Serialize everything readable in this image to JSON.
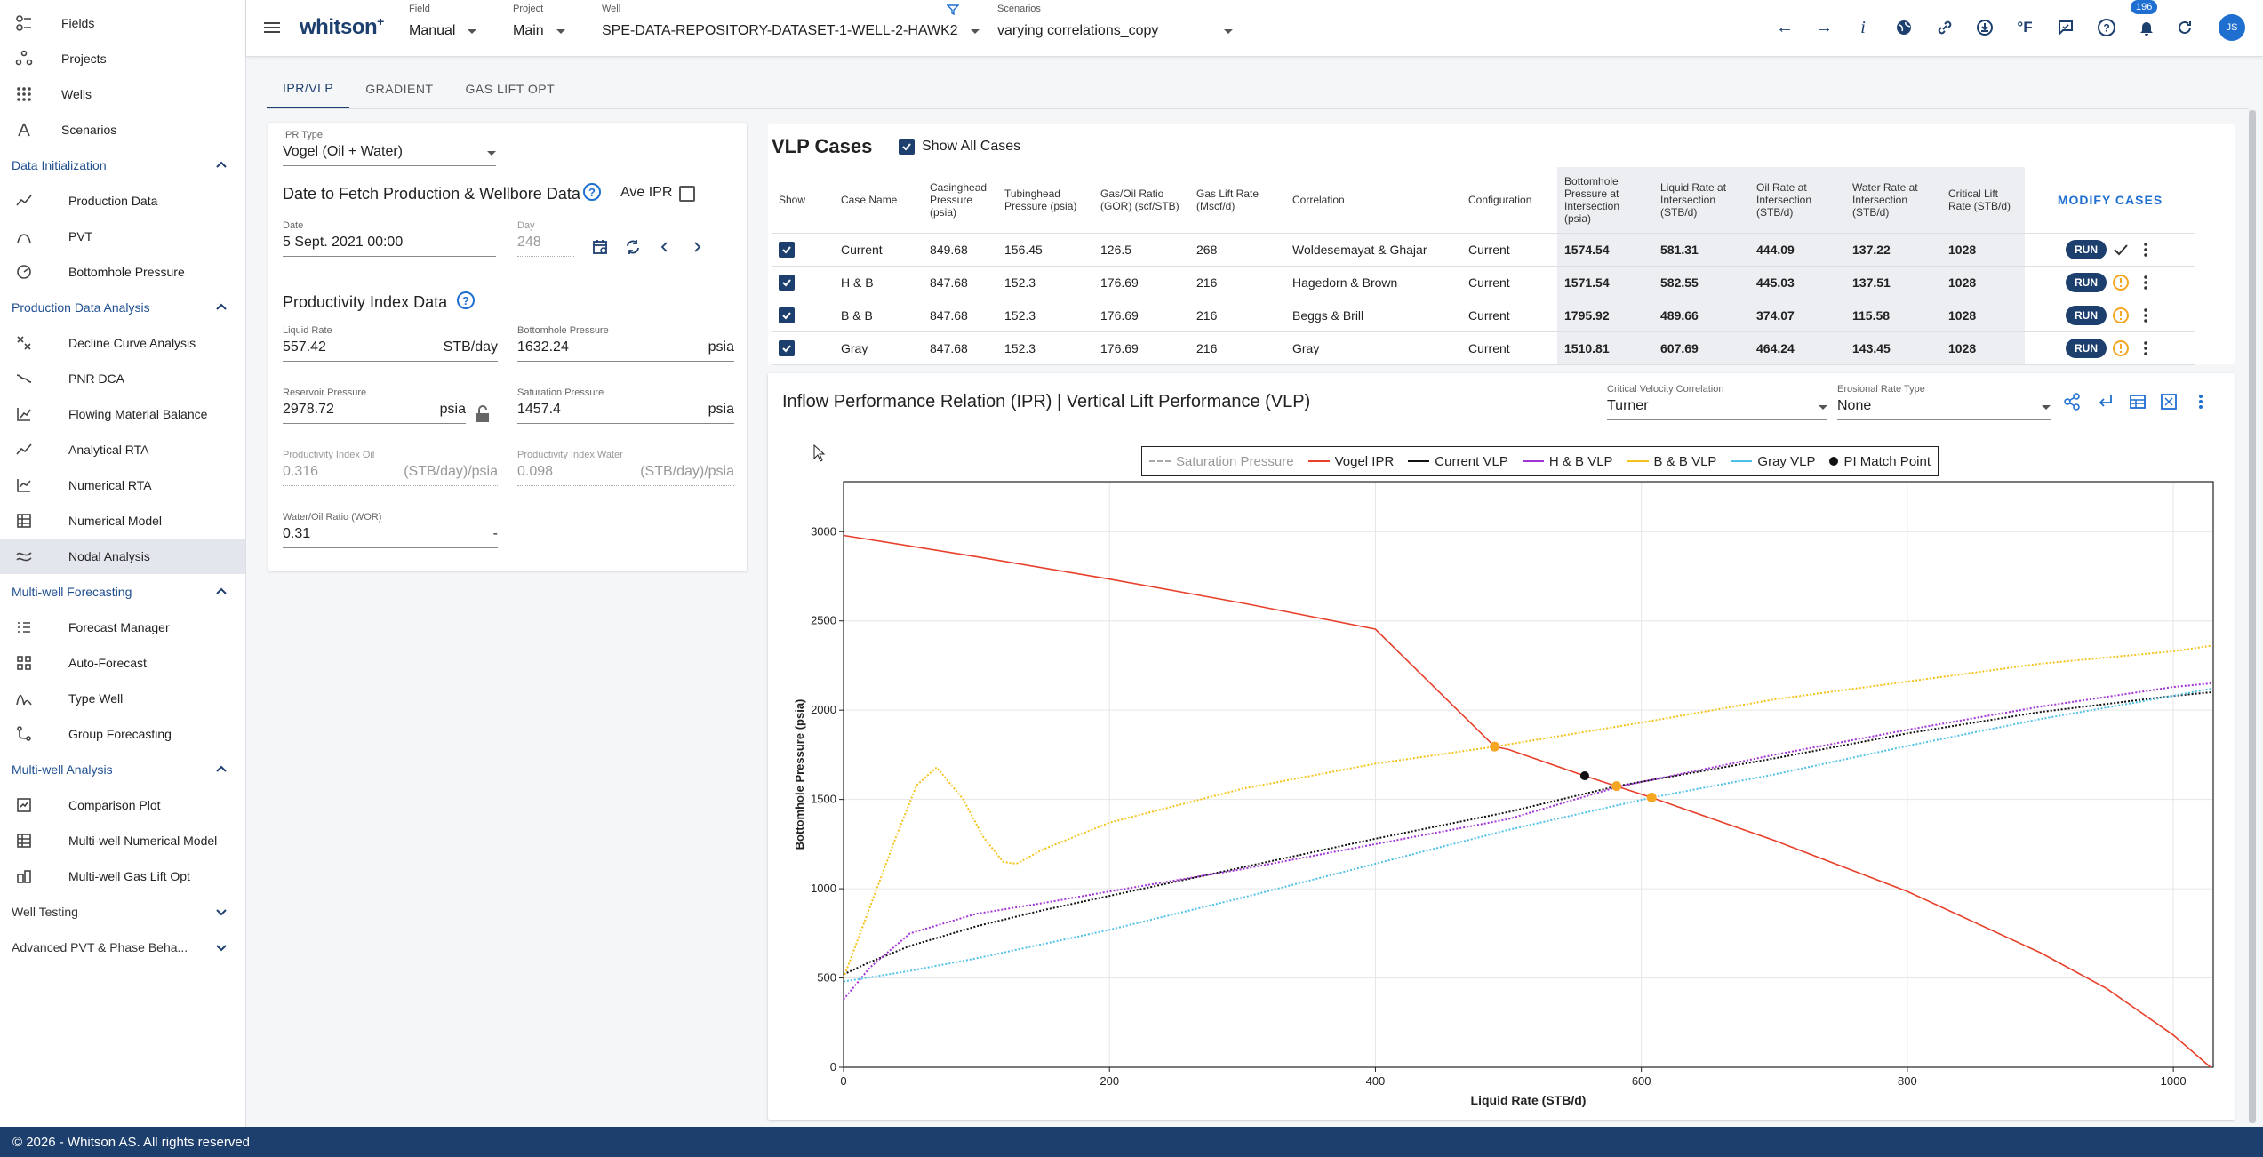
{
  "sidebar": {
    "top": [
      {
        "label": "Fields",
        "icon": "fields-icon"
      },
      {
        "label": "Projects",
        "icon": "projects-icon"
      },
      {
        "label": "Wells",
        "icon": "wells-icon"
      },
      {
        "label": "Scenarios",
        "icon": "scenarios-icon"
      }
    ],
    "sections": [
      {
        "label": "Data Initialization",
        "expanded": true,
        "items": [
          {
            "label": "Production Data",
            "icon": "production-data-icon"
          },
          {
            "label": "PVT",
            "icon": "pvt-icon"
          },
          {
            "label": "Bottomhole Pressure",
            "icon": "bottomhole-pressure-icon"
          }
        ]
      },
      {
        "label": "Production Data Analysis",
        "expanded": true,
        "items": [
          {
            "label": "Decline Curve Analysis",
            "icon": "decline-curve-icon"
          },
          {
            "label": "PNR DCA",
            "icon": "pnr-dca-icon"
          },
          {
            "label": "Flowing Material Balance",
            "icon": "flowing-material-balance-icon"
          },
          {
            "label": "Analytical RTA",
            "icon": "analytical-rta-icon"
          },
          {
            "label": "Numerical RTA",
            "icon": "numerical-rta-icon"
          },
          {
            "label": "Numerical Model",
            "icon": "numerical-model-icon"
          },
          {
            "label": "Nodal Analysis",
            "icon": "nodal-analysis-icon",
            "active": true
          }
        ]
      },
      {
        "label": "Multi-well Forecasting",
        "expanded": true,
        "items": [
          {
            "label": "Forecast Manager",
            "icon": "forecast-manager-icon"
          },
          {
            "label": "Auto-Forecast",
            "icon": "auto-forecast-icon"
          },
          {
            "label": "Type Well",
            "icon": "type-well-icon"
          },
          {
            "label": "Group Forecasting",
            "icon": "group-forecasting-icon"
          }
        ]
      },
      {
        "label": "Multi-well Analysis",
        "expanded": true,
        "items": [
          {
            "label": "Comparison Plot",
            "icon": "comparison-plot-icon"
          },
          {
            "label": "Multi-well Numerical Model",
            "icon": "multiwell-numerical-model-icon"
          },
          {
            "label": "Multi-well Gas Lift Opt",
            "icon": "multiwell-gas-lift-icon"
          }
        ]
      },
      {
        "label": "Well Testing",
        "expanded": false,
        "items": []
      },
      {
        "label": "Advanced PVT & Phase Beha...",
        "expanded": false,
        "items": []
      }
    ]
  },
  "footer": "© 2026 - Whitson AS. All rights reserved",
  "topbar": {
    "logo": "whitson",
    "logo_sup": "+",
    "field": {
      "caption": "Field",
      "value": "Manual"
    },
    "project": {
      "caption": "Project",
      "value": "Main"
    },
    "well": {
      "caption": "Well",
      "value": "SPE-DATA-REPOSITORY-DATASET-1-WELL-2-HAWK2"
    },
    "scenario": {
      "caption": "Scenarios",
      "value": "varying correlations_copy"
    },
    "unit_label": "°F",
    "notifications": "196",
    "avatar": "JS"
  },
  "tabs": [
    {
      "label": "IPR/VLP",
      "active": true
    },
    {
      "label": "GRADIENT"
    },
    {
      "label": "GAS LIFT OPT"
    }
  ],
  "ipr": {
    "type_caption": "IPR Type",
    "type_value": "Vogel (Oil + Water)",
    "date_section": "Date to Fetch Production & Wellbore Data",
    "ave_ipr": "Ave IPR",
    "date_caption": "Date",
    "date_value": "5 Sept. 2021 00:00",
    "day_caption": "Day",
    "day_value": "248",
    "pi_title": "Productivity Index Data",
    "liquid_rate": {
      "caption": "Liquid Rate",
      "value": "557.42",
      "unit": "STB/day"
    },
    "bhp": {
      "caption": "Bottomhole Pressure",
      "value": "1632.24",
      "unit": "psia"
    },
    "res_p": {
      "caption": "Reservoir Pressure",
      "value": "2978.72",
      "unit": "psia"
    },
    "sat_p": {
      "caption": "Saturation Pressure",
      "value": "1457.4",
      "unit": "psia"
    },
    "pi_oil": {
      "caption": "Productivity Index Oil",
      "value": "0.316",
      "unit": "(STB/day)/psia"
    },
    "pi_water": {
      "caption": "Productivity Index Water",
      "value": "0.098",
      "unit": "(STB/day)/psia"
    },
    "wor": {
      "caption": "Water/Oil Ratio (WOR)",
      "value": "0.31",
      "unit": "-"
    }
  },
  "vlp": {
    "title": "VLP Cases",
    "show_all": "Show All Cases",
    "modify": "MODIFY CASES",
    "run": "RUN",
    "headers": [
      "Show",
      "Case Name",
      "Casinghead Pressure (psia)",
      "Tubinghead Pressure (psia)",
      "Gas/Oil Ratio (GOR) (scf/STB)",
      "Gas Lift Rate (Mscf/d)",
      "Correlation",
      "Configuration",
      "Bottomhole Pressure at Intersection (psia)",
      "Liquid Rate at Intersection (STB/d)",
      "Oil Rate at Intersection (STB/d)",
      "Water Rate at Intersection (STB/d)",
      "Critical Lift Rate (STB/d)"
    ],
    "rows": [
      {
        "name": "Current",
        "chp": "849.68",
        "thp": "156.45",
        "gor": "126.5",
        "glr": "268",
        "corr": "Woldesemayat & Ghajar",
        "config": "Current",
        "bhp": "1574.54",
        "liq": "581.31",
        "oil": "444.09",
        "water": "137.22",
        "crit": "1028",
        "status": "check"
      },
      {
        "name": "H & B",
        "chp": "847.68",
        "thp": "152.3",
        "gor": "176.69",
        "glr": "216",
        "corr": "Hagedorn & Brown",
        "config": "Current",
        "bhp": "1571.54",
        "liq": "582.55",
        "oil": "445.03",
        "water": "137.51",
        "crit": "1028",
        "status": "warn"
      },
      {
        "name": "B & B",
        "chp": "847.68",
        "thp": "152.3",
        "gor": "176.69",
        "glr": "216",
        "corr": "Beggs & Brill",
        "config": "Current",
        "bhp": "1795.92",
        "liq": "489.66",
        "oil": "374.07",
        "water": "115.58",
        "crit": "1028",
        "status": "warn"
      },
      {
        "name": "Gray",
        "chp": "847.68",
        "thp": "152.3",
        "gor": "176.69",
        "glr": "216",
        "corr": "Gray",
        "config": "Current",
        "bhp": "1510.81",
        "liq": "607.69",
        "oil": "464.24",
        "water": "143.45",
        "crit": "1028",
        "status": "warn"
      }
    ]
  },
  "chart_panel": {
    "title": "Inflow Performance Relation (IPR) | Vertical Lift Performance (VLP)",
    "cvc_caption": "Critical Velocity Correlation",
    "cvc_value": "Turner",
    "ert_caption": "Erosional Rate Type",
    "ert_value": "None"
  },
  "colors": {
    "ipr": "#e8402a",
    "current": "#111111",
    "hb": "#a334d6",
    "bb": "#f5c21b",
    "gray": "#4fc1e8",
    "sat": "#aaaaaa",
    "pi": "#111111",
    "intersect": "#f5a623",
    "navy": "#1d3f6e"
  },
  "chart_data": {
    "type": "line",
    "xlabel": "Liquid Rate (STB/d)",
    "ylabel": "Bottomhole Pressure (psia)",
    "xlim": [
      0,
      1030
    ],
    "ylim": [
      0,
      3280
    ],
    "xticks": [
      0,
      200,
      400,
      600,
      800,
      1000
    ],
    "yticks": [
      0,
      500,
      1000,
      1500,
      2000,
      2500,
      3000
    ],
    "grid": true,
    "legend": "top",
    "series": [
      {
        "name": "Saturation Pressure",
        "style": "dashed",
        "points": []
      },
      {
        "name": "Vogel IPR",
        "style": "solid",
        "points": [
          [
            0,
            2978.72
          ],
          [
            100,
            2860
          ],
          [
            200,
            2734
          ],
          [
            300,
            2600
          ],
          [
            400,
            2454
          ],
          [
            489.66,
            1795.92
          ],
          [
            500,
            1780
          ],
          [
            557.42,
            1632.24
          ],
          [
            581.31,
            1574.54
          ],
          [
            607.69,
            1510.81
          ],
          [
            700,
            1270
          ],
          [
            800,
            985
          ],
          [
            900,
            642
          ],
          [
            950,
            440
          ],
          [
            1000,
            180
          ],
          [
            1028,
            0
          ]
        ]
      },
      {
        "name": "Current VLP",
        "style": "dotted",
        "points": [
          [
            0,
            520
          ],
          [
            20,
            590
          ],
          [
            50,
            680
          ],
          [
            100,
            790
          ],
          [
            150,
            880
          ],
          [
            200,
            960
          ],
          [
            300,
            1120
          ],
          [
            400,
            1280
          ],
          [
            500,
            1430
          ],
          [
            581.31,
            1574.54
          ],
          [
            700,
            1730
          ],
          [
            800,
            1870
          ],
          [
            900,
            1990
          ],
          [
            1000,
            2080
          ],
          [
            1028,
            2100
          ]
        ]
      },
      {
        "name": "H & B VLP",
        "style": "dotted",
        "points": [
          [
            0,
            380
          ],
          [
            20,
            560
          ],
          [
            50,
            750
          ],
          [
            100,
            860
          ],
          [
            150,
            920
          ],
          [
            200,
            985
          ],
          [
            300,
            1110
          ],
          [
            400,
            1250
          ],
          [
            500,
            1390
          ],
          [
            582.55,
            1571.54
          ],
          [
            700,
            1750
          ],
          [
            800,
            1890
          ],
          [
            900,
            2020
          ],
          [
            1000,
            2130
          ],
          [
            1028,
            2150
          ]
        ]
      },
      {
        "name": "B & B VLP",
        "style": "dotted",
        "points": [
          [
            0,
            500
          ],
          [
            20,
            900
          ],
          [
            40,
            1300
          ],
          [
            55,
            1580
          ],
          [
            70,
            1680
          ],
          [
            90,
            1500
          ],
          [
            105,
            1290
          ],
          [
            120,
            1150
          ],
          [
            130,
            1140
          ],
          [
            150,
            1220
          ],
          [
            200,
            1370
          ],
          [
            300,
            1560
          ],
          [
            400,
            1700
          ],
          [
            489.66,
            1795.92
          ],
          [
            600,
            1930
          ],
          [
            700,
            2060
          ],
          [
            800,
            2160
          ],
          [
            900,
            2260
          ],
          [
            1000,
            2330
          ],
          [
            1028,
            2360
          ]
        ]
      },
      {
        "name": "Gray VLP",
        "style": "dotted",
        "points": [
          [
            0,
            480
          ],
          [
            50,
            540
          ],
          [
            100,
            610
          ],
          [
            200,
            770
          ],
          [
            300,
            950
          ],
          [
            400,
            1140
          ],
          [
            500,
            1330
          ],
          [
            607.69,
            1510.81
          ],
          [
            700,
            1640
          ],
          [
            800,
            1800
          ],
          [
            900,
            1950
          ],
          [
            1000,
            2080
          ],
          [
            1028,
            2120
          ]
        ]
      }
    ],
    "pi_match_point": {
      "name": "PI Match Point",
      "x": 557.42,
      "y": 1632.24
    },
    "intersections": [
      [
        489.66,
        1795.92
      ],
      [
        581.31,
        1574.54
      ],
      [
        607.69,
        1510.81
      ]
    ]
  }
}
